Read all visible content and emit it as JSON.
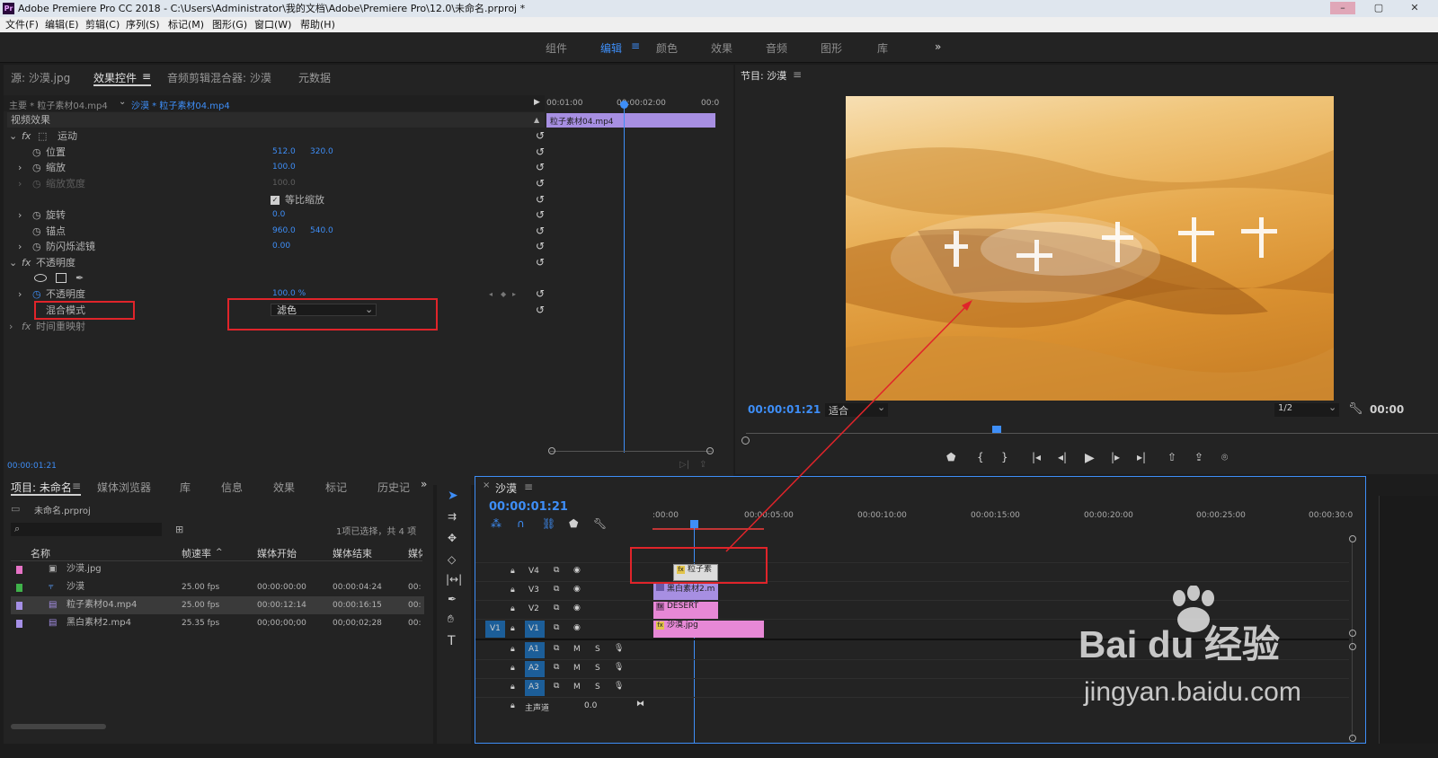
{
  "window": {
    "title": "Adobe Premiere Pro CC 2018 - C:\\Users\\Administrator\\我的文档\\Adobe\\Premiere Pro\\12.0\\未命名.prproj *",
    "logo": "Pr"
  },
  "menu": [
    "文件(F)",
    "编辑(E)",
    "剪辑(C)",
    "序列(S)",
    "标记(M)",
    "图形(G)",
    "窗口(W)",
    "帮助(H)"
  ],
  "workspaces": [
    "组件",
    "编辑",
    "颜色",
    "效果",
    "音频",
    "图形",
    "库"
  ],
  "workspace_more": "»",
  "source_tabs": [
    "源: 沙漠.jpg",
    "效果控件",
    "音频剪辑混合器: 沙漠",
    "元数据"
  ],
  "effect_controls": {
    "master": "主要 * 粒子素材04.mp4",
    "sequence_clip": "沙漠 * 粒子素材04.mp4",
    "video_effects": "视频效果",
    "motion": "运动",
    "position": {
      "label": "位置",
      "x": "512.0",
      "y": "320.0"
    },
    "scale": {
      "label": "缩放",
      "value": "100.0"
    },
    "scale_width": {
      "label": "缩放宽度",
      "value": "100.0"
    },
    "uniform_scale": "等比缩放",
    "rotation": {
      "label": "旋转",
      "value": "0.0"
    },
    "anchor": {
      "label": "锚点",
      "x": "960.0",
      "y": "540.0"
    },
    "antiflicker": {
      "label": "防闪烁滤镜",
      "value": "0.00"
    },
    "opacity_group": "不透明度",
    "opacity": {
      "label": "不透明度",
      "value": "100.0 %"
    },
    "blend_mode": {
      "label": "混合模式",
      "value": "滤色"
    },
    "time_remap": "时间重映射",
    "timecode": "00:00:01:21",
    "mini_ruler": [
      "00:01:00",
      "00:00:02:00",
      "00:0"
    ],
    "mini_clip": "粒子素材04.mp4"
  },
  "program_monitor": {
    "tab": "节目: 沙漠",
    "timecode": "00:00:01:21",
    "fit": "适合",
    "resolution": "1/2",
    "duration": "00:00"
  },
  "project_panel": {
    "tabs": [
      "项目: 未命名",
      "媒体浏览器",
      "库",
      "信息",
      "效果",
      "标记",
      "历史记"
    ],
    "filename": "未命名.prproj",
    "selection_info": "1项已选择，共 4 项",
    "columns": [
      "名称",
      "帧速率",
      "媒体开始",
      "媒体结束",
      "媒体"
    ],
    "rows": [
      {
        "name": "沙漠.jpg",
        "fps": "",
        "start": "",
        "end": "",
        "extra": "",
        "color": "#e673c6"
      },
      {
        "name": "沙漠",
        "fps": "25.00 fps",
        "start": "00:00:00:00",
        "end": "00:00:04:24",
        "extra": "00:",
        "color": "#3fb24a"
      },
      {
        "name": "粒子素材04.mp4",
        "fps": "25.00 fps",
        "start": "00:00:12:14",
        "end": "00:00:16:15",
        "extra": "00:",
        "color": "#a58fe6"
      },
      {
        "name": "黑白素材2.mp4",
        "fps": "25.35 fps",
        "start": "00;00;00;00",
        "end": "00;00;02;28",
        "extra": "00:",
        "color": "#a58fe6"
      }
    ]
  },
  "timeline": {
    "tab": "沙漠",
    "timecode": "00:00:01:21",
    "ruler": [
      ":00:00",
      "00:00:05:00",
      "00:00:10:00",
      "00:00:15:00",
      "00:00:20:00",
      "00:00:25:00",
      "00:00:30:0"
    ],
    "video_tracks": [
      "V4",
      "V3",
      "V2",
      "V1"
    ],
    "audio_tracks": [
      "A1",
      "A2",
      "A3"
    ],
    "source_patch": "V1",
    "master": {
      "label": "主声道",
      "value": "0.0"
    },
    "clips": [
      {
        "name": "粒子素",
        "track": "V4"
      },
      {
        "name": "黑白素材2.m",
        "track": "V3"
      },
      {
        "name": "DESERT",
        "track": "V2"
      },
      {
        "name": "沙漠.jpg",
        "track": "V1"
      }
    ],
    "track_buttons": {
      "mute": "M",
      "solo": "S"
    }
  },
  "watermark": {
    "brand": "Bai du 经验",
    "url": "jingyan.baidu.com"
  }
}
